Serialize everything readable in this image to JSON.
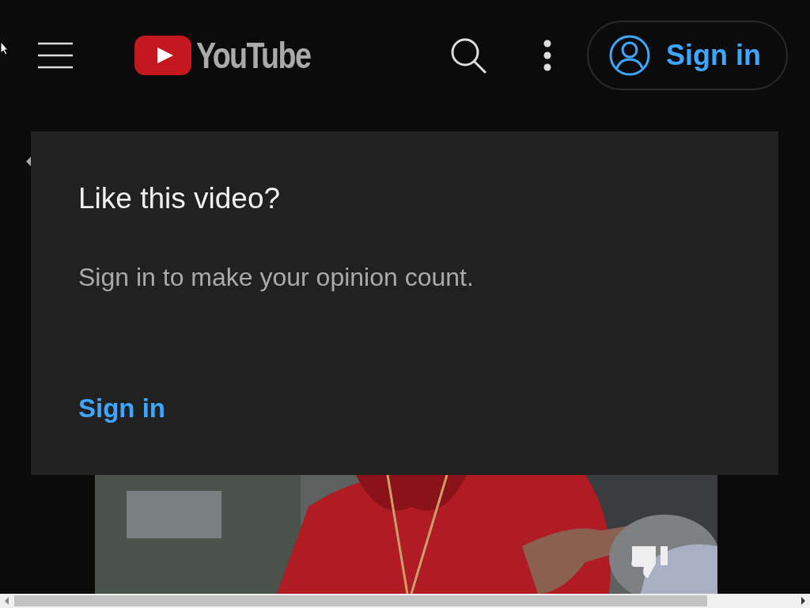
{
  "header": {
    "logo_text": "YouTube",
    "sign_in_button": "Sign in"
  },
  "popup": {
    "title": "Like this video?",
    "message": "Sign in to make your opinion count.",
    "action": "Sign in"
  }
}
